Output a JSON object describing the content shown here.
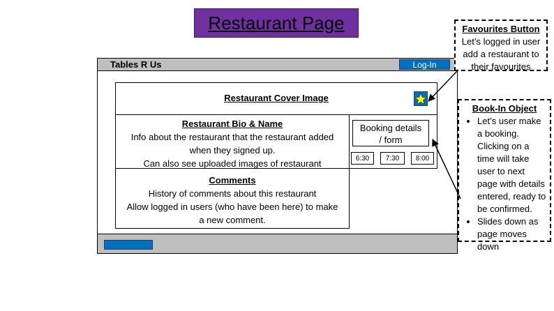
{
  "title": "Restaurant Page",
  "window": {
    "site_name": "Tables R Us",
    "login_label": "Log-In"
  },
  "cover": {
    "label": "Restaurant Cover Image"
  },
  "bio": {
    "heading": "Restaurant Bio & Name",
    "lines": [
      "Info about the restaurant that the restaurant added",
      "when they signed up.",
      "Can also see uploaded images of restaurant"
    ]
  },
  "comments": {
    "heading": "Comments",
    "lines": [
      "History of comments about this restaurant",
      "Allow logged in users (who have been here) to make",
      "a new comment."
    ]
  },
  "booking": {
    "form_lines": [
      "Booking details",
      "/ form"
    ],
    "times": [
      "6:30",
      "7:30",
      "8:00"
    ]
  },
  "favourites_callout": {
    "title": "Favourites Button",
    "lines": [
      "Let’s logged in user",
      "add a restaurant to",
      "their favourites"
    ]
  },
  "bookin_callout": {
    "title": "Book-In Object",
    "bullets": [
      "Let’s user make a booking. Clicking on a time will take user to next page with details entered, ready to be confirmed.",
      "Slides down as page moves down"
    ]
  },
  "colors": {
    "title_bg": "#7030a0",
    "bar_grey": "#bfbfbf",
    "button_blue": "#0070c0",
    "star_yellow": "#ffff00"
  },
  "icons": [
    "star-icon",
    "arrow-icon"
  ]
}
